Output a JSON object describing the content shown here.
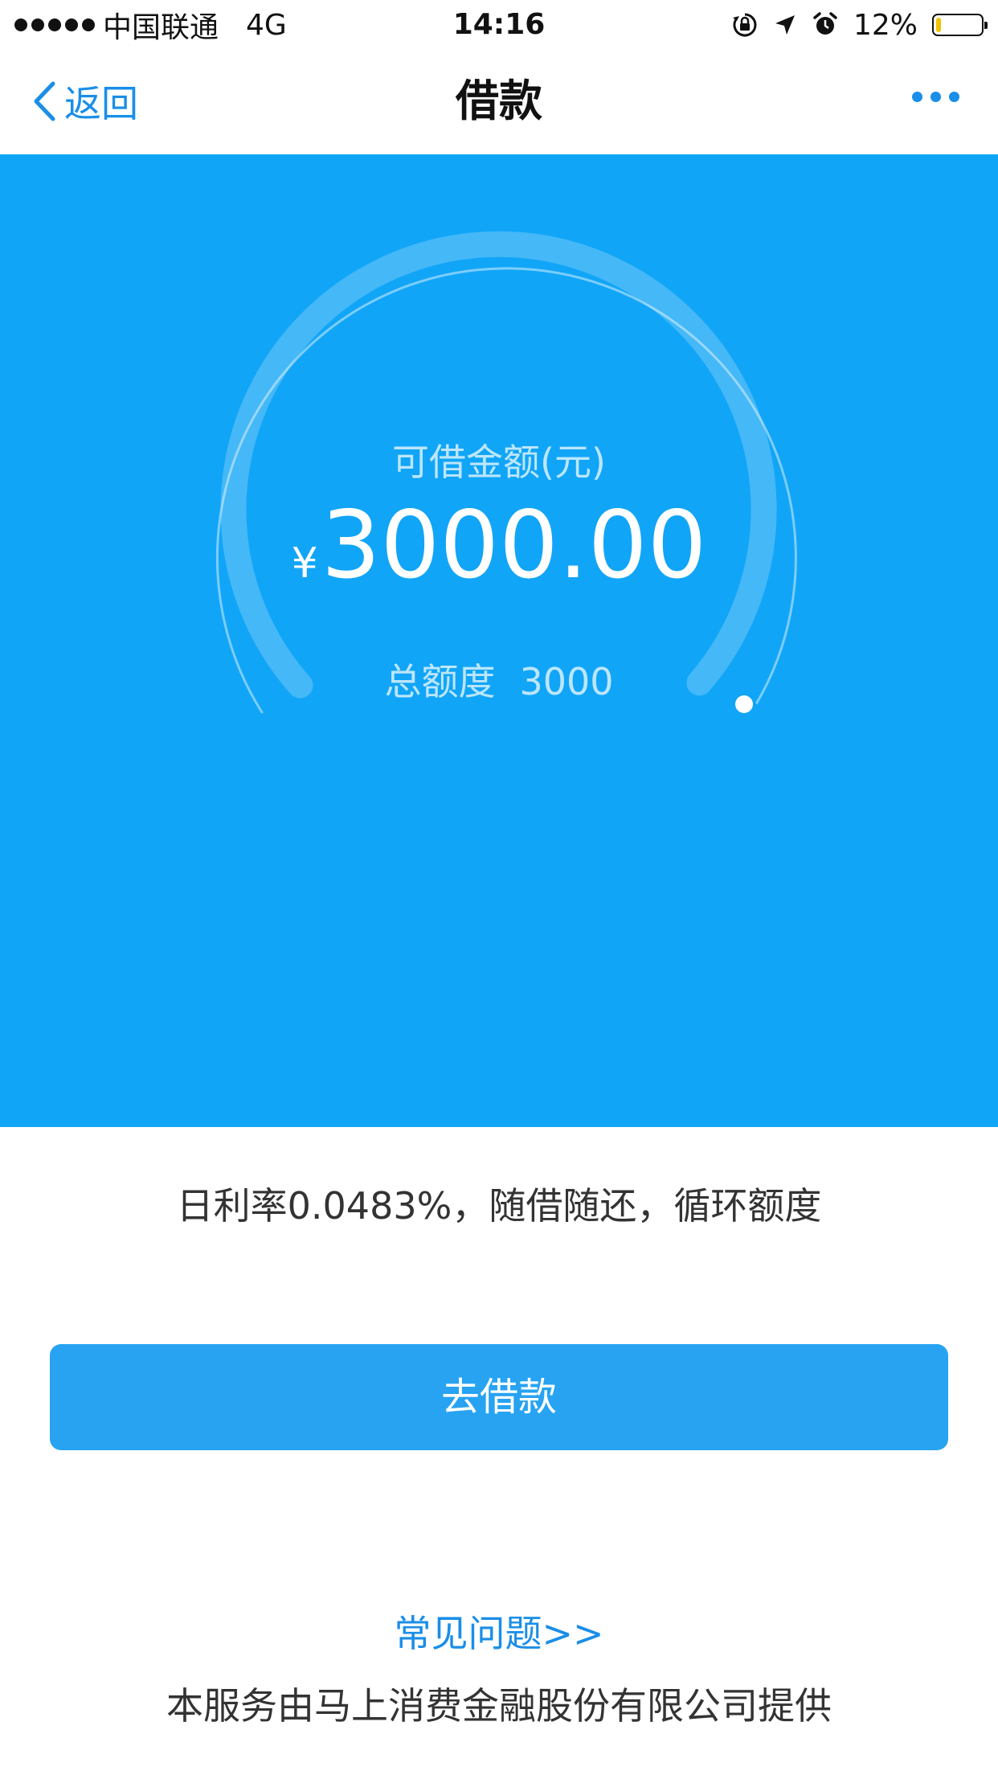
{
  "status_bar": {
    "carrier": "中国联通",
    "network": "4G",
    "time": "14:16",
    "battery": "12%",
    "battery_level": 0.12,
    "icons": [
      "rotation-lock-icon",
      "location-arrow-icon",
      "alarm-icon",
      "battery-icon"
    ]
  },
  "nav": {
    "back_label": "返回",
    "title": "借款",
    "more_icon": "more-dots-icon"
  },
  "loan": {
    "available_label": "可借金额(元)",
    "currency_symbol": "¥",
    "available_amount": "3000.00",
    "total_label": "总额度",
    "total_amount": "3000",
    "available_ratio": 1.0
  },
  "info": {
    "rate_text": "日利率0.0483%，随借随还，循环额度"
  },
  "actions": {
    "borrow_label": "去借款"
  },
  "footer": {
    "faq_label": "常见问题>>",
    "provider_text": "本服务由马上消费金融股份有限公司提供"
  },
  "colors": {
    "hero_bg": "#11a5f7",
    "accent": "#1a8ee8",
    "button_bg": "#27a3f2"
  }
}
